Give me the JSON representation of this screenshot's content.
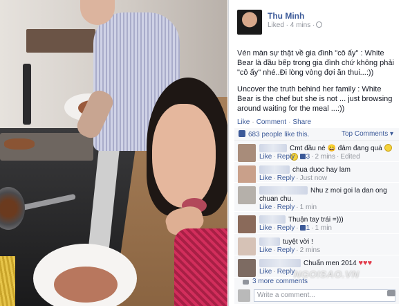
{
  "post": {
    "author": "Thu Minh",
    "meta": "Liked · 4 mins ·",
    "caption_vi": "Vén màn sự thật về gia đình \"cô ấy\" : White Bear là đầu bếp trong gia đình chứ không phải \"cô ấy\" nhé..Đi lòng vòng đợi ăn thui...:))",
    "caption_en": "Uncover the truth behind her family : White Bear is the chef but she is not ... just browsing around waiting for the meal ...:))",
    "actions": {
      "like": "Like",
      "comment": "Comment",
      "share": "Share"
    },
    "likes_text": "683 people like this.",
    "top_comments": "Top Comments ▾"
  },
  "comments": [
    {
      "text": "Cmt đầu né 😄 đảm đang quá",
      "like": "Like",
      "reply": "Reply",
      "likes": "3",
      "time": "2 mins",
      "extra": "Edited"
    },
    {
      "text": "chua duoc hay lam",
      "like": "Like",
      "reply": "Reply",
      "time": "Just now"
    },
    {
      "text_line1": "Nhu z moi goi la dan ong",
      "text_line2": "chuan chu.",
      "like": "Like",
      "reply": "Reply",
      "time": "1 min"
    },
    {
      "text": "Thuận tay trái =)))",
      "like": "Like",
      "reply": "Reply",
      "likes": "1",
      "time": "1 min"
    },
    {
      "text": "tuyệt vời !",
      "like": "Like",
      "reply": "Reply",
      "time": "2 mins"
    },
    {
      "text": "Chuẩn men 2014",
      "like": "Like",
      "reply": "Reply"
    }
  ],
  "more_comments": "3 more comments",
  "write_placeholder": "Write a comment...",
  "watermark": "NGOISAO.VN",
  "icons": {
    "globe": "globe-icon",
    "thumb": "thumbs-up-icon",
    "camera": "camera-icon",
    "bubble": "comment-bubble-icon"
  },
  "colors": {
    "link": "#3b5998",
    "meta": "#90949c",
    "panel_bg": "#f6f7f9"
  }
}
